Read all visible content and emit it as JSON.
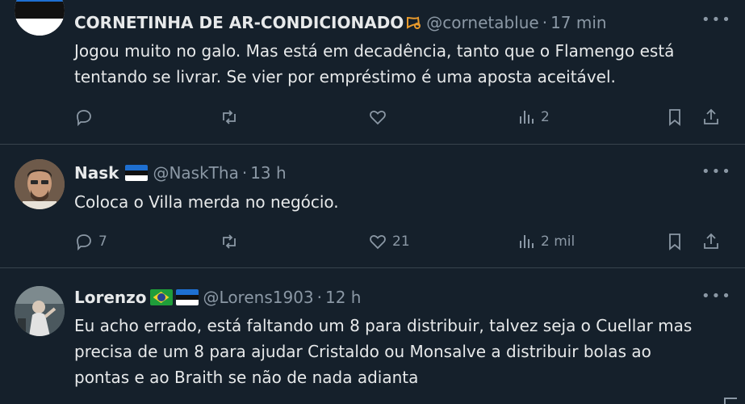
{
  "tweets": [
    {
      "name": "CORNETINHA DE AR-CONDICIONADO",
      "handle": "@cornetablue",
      "time": "17 min",
      "text_lines": [
        "Jogou muito no galo. Mas está em decadência, tanto que o Flamengo está",
        "tentando se livrar. Se vier por empréstimo é uma aposta aceitável."
      ],
      "replies": "",
      "retweets": "",
      "likes": "",
      "views": "2"
    },
    {
      "name": "Nask",
      "handle": "@NaskTha",
      "time": "13 h",
      "text_lines": [
        "Coloca o Villa merda no negócio."
      ],
      "replies": "7",
      "retweets": "",
      "likes": "21",
      "views": "2 mil"
    },
    {
      "name": "Lorenzo",
      "handle": "@Lorens1903",
      "time": "12 h",
      "text_lines": [
        "Eu acho errado, está faltando um 8 para distribuir, talvez seja o Cuellar mas",
        "precisa de um 8 para ajudar Cristaldo ou Monsalve a distribuir bolas ao",
        "pontas e ao Braith se não de nada adianta"
      ]
    }
  ],
  "separator": "·",
  "more_label": "•••",
  "colors": {
    "background": "#15202b",
    "text": "#e7e9ea",
    "muted": "#8b98a5",
    "divider": "#38444d",
    "estonia_blue": "#1e6fd0",
    "horn_orange": "#e89a2c"
  }
}
